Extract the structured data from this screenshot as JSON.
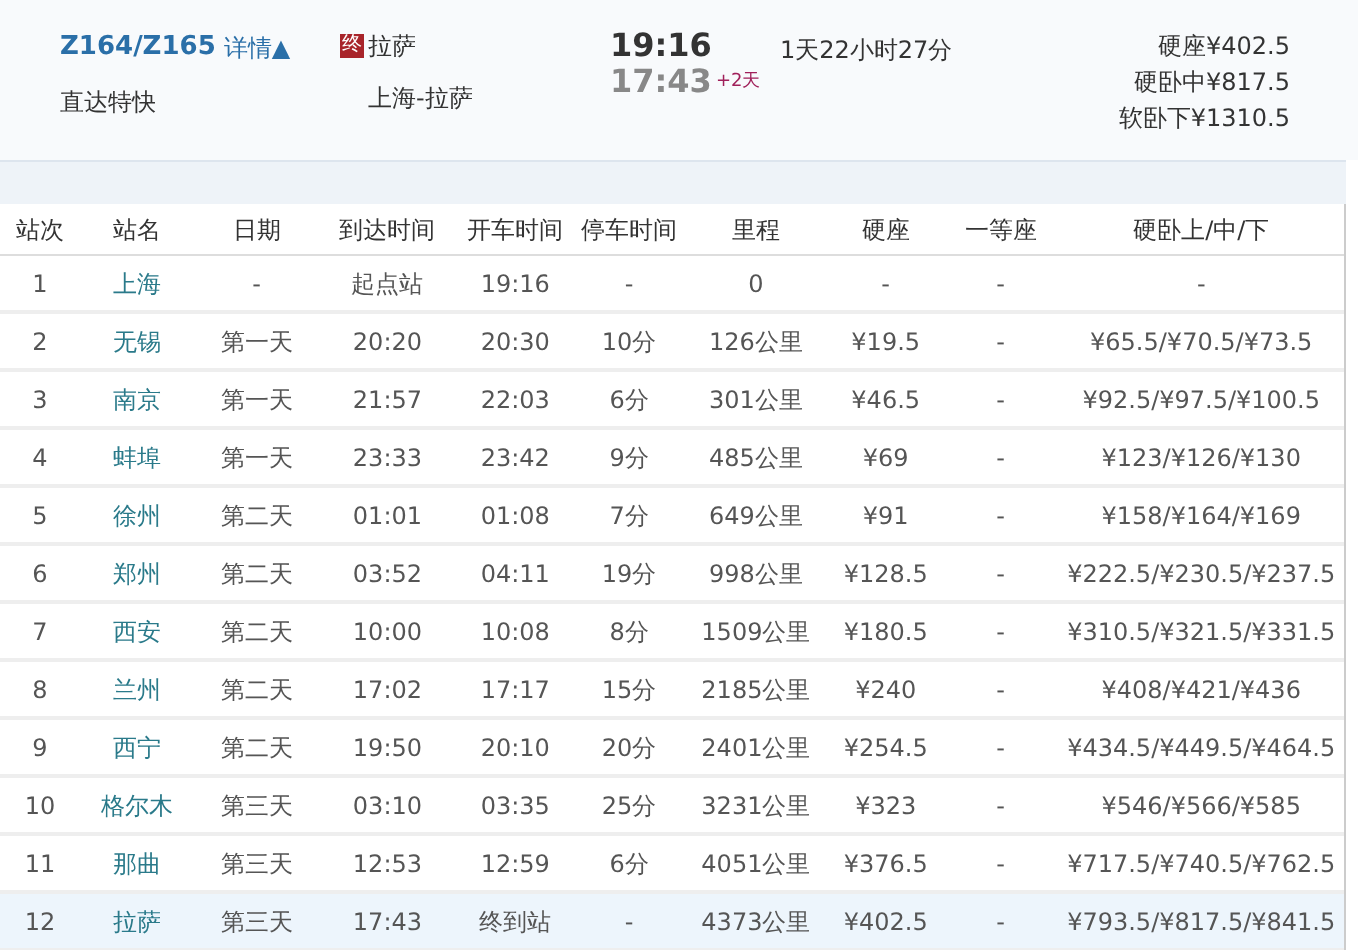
{
  "train": {
    "number": "Z164/Z165",
    "details_link": "详情▲",
    "type": "直达特快",
    "terminal_badge": "终",
    "terminal": "拉萨",
    "route": "上海-拉萨",
    "depart_time": "19:16",
    "arrive_time": "17:43",
    "day_offset": "+2天",
    "duration": "1天22小时27分",
    "prices": [
      "硬座¥402.5",
      "硬卧中¥817.5",
      "软卧下¥1310.5"
    ]
  },
  "table": {
    "columns": [
      "站次",
      "站名",
      "日期",
      "到达时间",
      "开车时间",
      "停车时间",
      "里程",
      "硬座",
      "一等座",
      "硬卧上/中/下"
    ],
    "rows": [
      {
        "cells": [
          "1",
          "上海",
          "-",
          "起点站",
          "19:16",
          "-",
          "0",
          "-",
          "-",
          "-"
        ],
        "selected": false
      },
      {
        "cells": [
          "2",
          "无锡",
          "第一天",
          "20:20",
          "20:30",
          "10分",
          "126公里",
          "¥19.5",
          "-",
          "¥65.5/¥70.5/¥73.5"
        ],
        "selected": false
      },
      {
        "cells": [
          "3",
          "南京",
          "第一天",
          "21:57",
          "22:03",
          "6分",
          "301公里",
          "¥46.5",
          "-",
          "¥92.5/¥97.5/¥100.5"
        ],
        "selected": false
      },
      {
        "cells": [
          "4",
          "蚌埠",
          "第一天",
          "23:33",
          "23:42",
          "9分",
          "485公里",
          "¥69",
          "-",
          "¥123/¥126/¥130"
        ],
        "selected": false
      },
      {
        "cells": [
          "5",
          "徐州",
          "第二天",
          "01:01",
          "01:08",
          "7分",
          "649公里",
          "¥91",
          "-",
          "¥158/¥164/¥169"
        ],
        "selected": false
      },
      {
        "cells": [
          "6",
          "郑州",
          "第二天",
          "03:52",
          "04:11",
          "19分",
          "998公里",
          "¥128.5",
          "-",
          "¥222.5/¥230.5/¥237.5"
        ],
        "selected": false
      },
      {
        "cells": [
          "7",
          "西安",
          "第二天",
          "10:00",
          "10:08",
          "8分",
          "1509公里",
          "¥180.5",
          "-",
          "¥310.5/¥321.5/¥331.5"
        ],
        "selected": false
      },
      {
        "cells": [
          "8",
          "兰州",
          "第二天",
          "17:02",
          "17:17",
          "15分",
          "2185公里",
          "¥240",
          "-",
          "¥408/¥421/¥436"
        ],
        "selected": false
      },
      {
        "cells": [
          "9",
          "西宁",
          "第二天",
          "19:50",
          "20:10",
          "20分",
          "2401公里",
          "¥254.5",
          "-",
          "¥434.5/¥449.5/¥464.5"
        ],
        "selected": false
      },
      {
        "cells": [
          "10",
          "格尔木",
          "第三天",
          "03:10",
          "03:35",
          "25分",
          "3231公里",
          "¥323",
          "-",
          "¥546/¥566/¥585"
        ],
        "selected": false
      },
      {
        "cells": [
          "11",
          "那曲",
          "第三天",
          "12:53",
          "12:59",
          "6分",
          "4051公里",
          "¥376.5",
          "-",
          "¥717.5/¥740.5/¥762.5"
        ],
        "selected": false
      },
      {
        "cells": [
          "12",
          "拉萨",
          "第三天",
          "17:43",
          "终到站",
          "-",
          "4373公里",
          "¥402.5",
          "-",
          "¥793.5/¥817.5/¥841.5"
        ],
        "selected": true
      }
    ]
  }
}
